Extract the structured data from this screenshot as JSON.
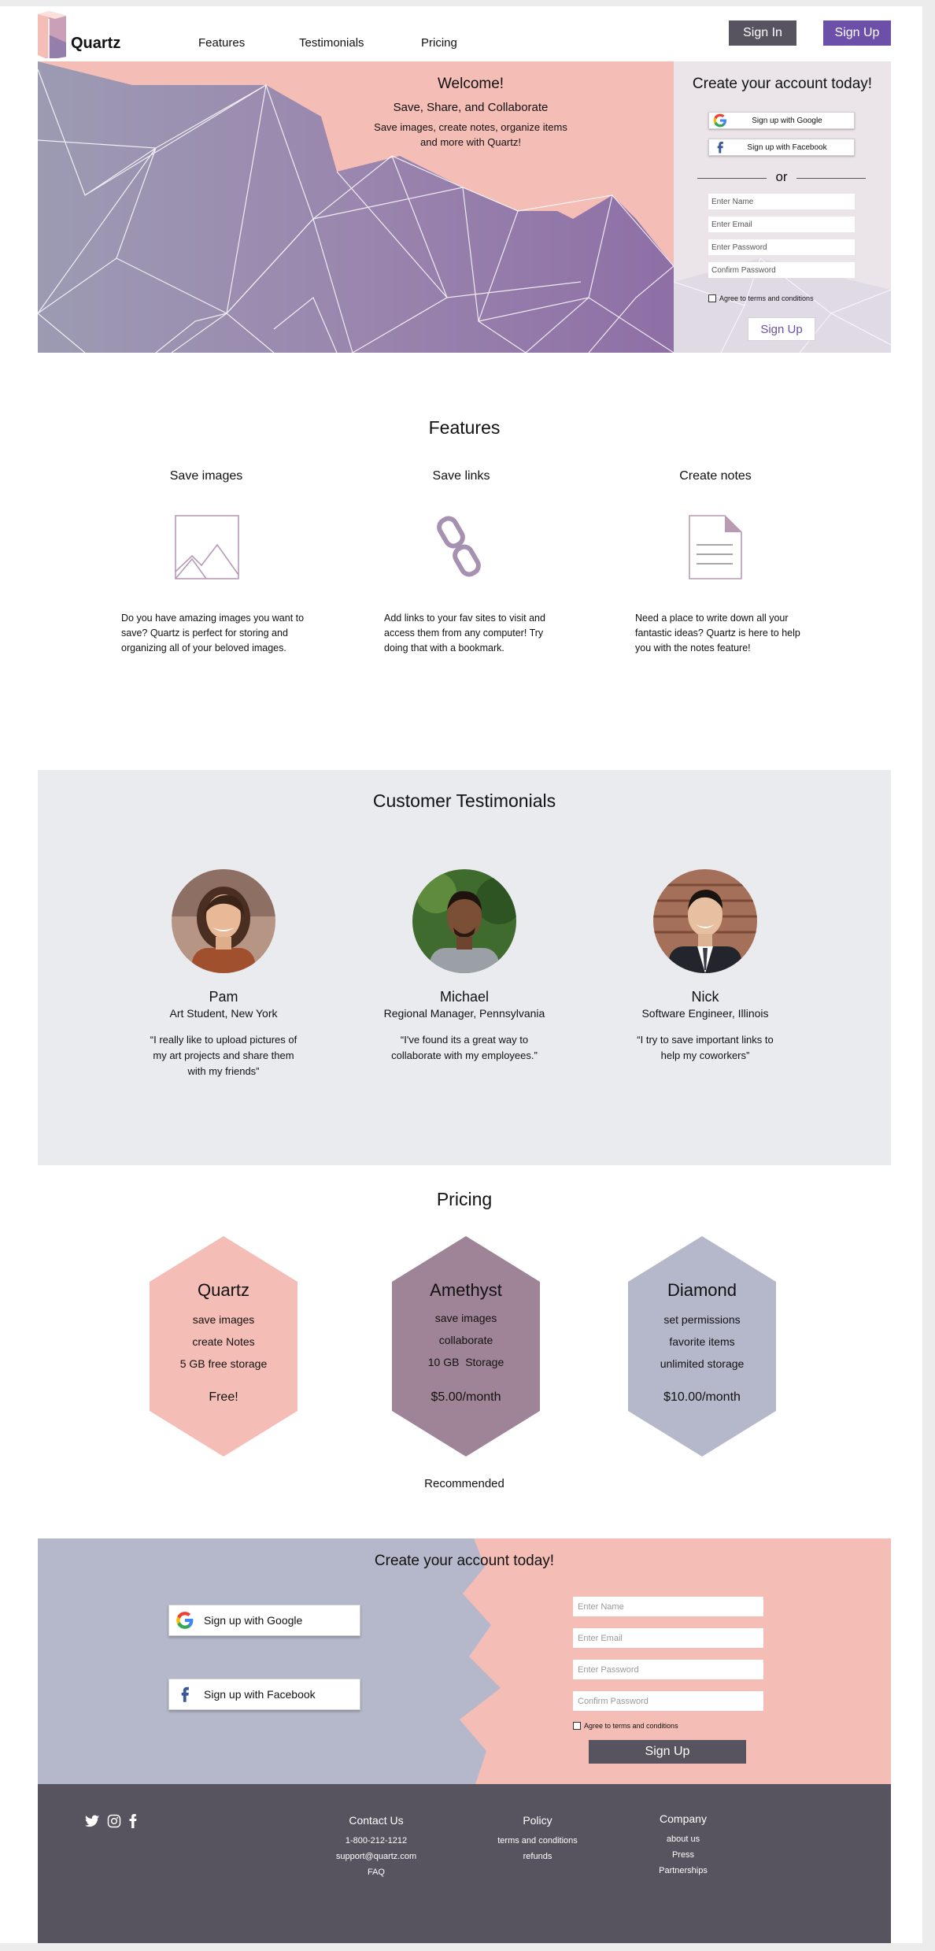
{
  "brand": {
    "name": "Quartz"
  },
  "nav": [
    {
      "label": "Features"
    },
    {
      "label": "Testimonials"
    },
    {
      "label": "Pricing"
    }
  ],
  "header": {
    "signin_label": "Sign In",
    "signup_label": "Sign Up"
  },
  "hero": {
    "welcome": "Welcome!",
    "tagline": "Save, Share, and Collaborate",
    "subtitle_line1": "Save images, create notes, organize items",
    "subtitle_line2": "and more with Quartz!"
  },
  "hero_form": {
    "title": "Create your account today!",
    "google_label": "Sign up with Google",
    "facebook_label": "Sign up with Facebook",
    "or_label": "or",
    "name_placeholder": "Enter Name",
    "email_placeholder": "Enter Email",
    "password_placeholder": "Enter Password",
    "confirm_placeholder": "Confirm Password",
    "terms_label": "Agree to terms and conditions",
    "submit_label": "Sign Up"
  },
  "features": {
    "title": "Features",
    "items": [
      {
        "title": "Save images",
        "icon": "image-icon",
        "desc_lines": [
          "Do you have amazing images you want to",
          "save? Quartz is perfect for storing and",
          "organizing all of your beloved images."
        ]
      },
      {
        "title": "Save links",
        "icon": "link-icon",
        "desc_lines": [
          "Add links to your fav sites to visit and",
          "access them from any computer! Try",
          "doing that with a bookmark."
        ]
      },
      {
        "title": "Create notes",
        "icon": "note-icon",
        "desc_lines": [
          "Need a place to write down all your",
          "fantastic ideas? Quartz is here to help",
          "you with the notes feature!"
        ]
      }
    ]
  },
  "testimonials": {
    "title": "Customer Testimonials",
    "items": [
      {
        "name": "Pam",
        "role": "Art Student, New York",
        "quote_lines": [
          "“I really like to upload pictures of",
          "my art projects and share them",
          "with my friends”"
        ]
      },
      {
        "name": "Michael",
        "role": "Regional Manager, Pennsylvania",
        "quote_lines": [
          "“I've found its a great way to",
          "collaborate with my employees.”"
        ]
      },
      {
        "name": "Nick",
        "role": "Software Engineer, Illinois",
        "quote_lines": [
          "“I try to save important links to",
          "help my coworkers”"
        ]
      }
    ]
  },
  "pricing": {
    "title": "Pricing",
    "plans": [
      {
        "name": "Quartz",
        "items": [
          "save images",
          "create Notes",
          "5 GB free storage"
        ],
        "price": "Free!",
        "color": "#f4bdb6"
      },
      {
        "name": "Amethyst",
        "items": [
          "save images",
          "collaborate",
          "10 GB  Storage"
        ],
        "price": "$5.00/month",
        "color": "#9f8498"
      },
      {
        "name": "Diamond",
        "items": [
          "set permissions",
          "favorite items",
          "unlimited storage"
        ],
        "price": "$10.00/month",
        "color": "#b5b8ca"
      }
    ],
    "recommended": "Recommended"
  },
  "bottom_form": {
    "title": "Create your account today!",
    "google_label": "Sign up with Google",
    "facebook_label": "Sign up with Facebook",
    "name_placeholder": "Enter Name",
    "email_placeholder": "Enter Email",
    "password_placeholder": "Enter Password",
    "confirm_placeholder": "Confirm Password",
    "terms_label": "Agree to terms and conditions",
    "submit_label": "Sign Up"
  },
  "footer": {
    "social_icons": [
      "twitter-icon",
      "instagram-icon",
      "facebook-icon"
    ],
    "contact": {
      "heading": "Contact Us",
      "links": [
        "1-800-212-1212",
        "support@quartz.com",
        "FAQ"
      ]
    },
    "policy": {
      "heading": "Policy",
      "links": [
        "terms and conditions",
        "refunds"
      ]
    },
    "company": {
      "heading": "Company",
      "links": [
        "about us",
        "Press",
        "Partnerships"
      ]
    }
  },
  "colors": {
    "accent_purple": "#6b4fa8",
    "dark_gray": "#57535f",
    "pink": "#f4bdb6",
    "lavender_gray": "#b5b8ca",
    "panel_bg": "#ebe4e8",
    "testimonial_bg": "#eaebef"
  }
}
